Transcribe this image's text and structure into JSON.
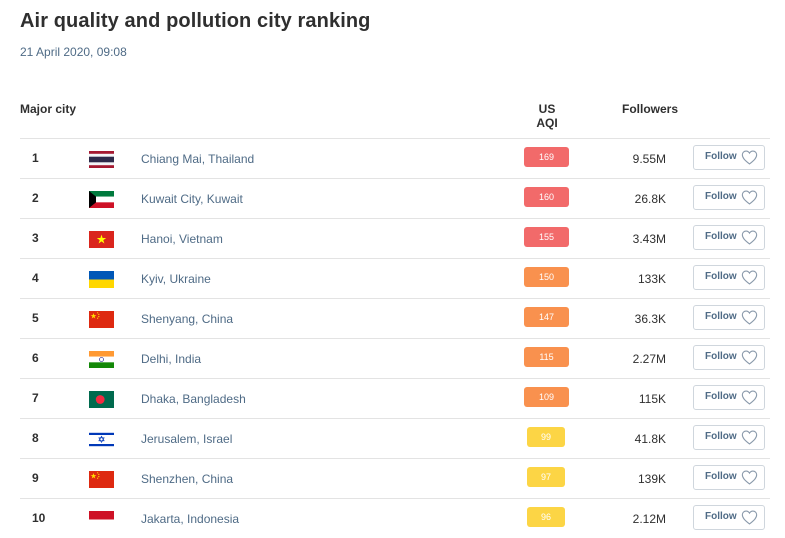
{
  "page": {
    "title": "Air quality and pollution city ranking",
    "datetime": "21 April 2020, 09:08"
  },
  "table": {
    "headers": {
      "city": "Major city",
      "aqi": "US AQI",
      "followers": "Followers"
    },
    "follow_label": "Follow",
    "rows": [
      {
        "rank": "1",
        "flag": "thailand",
        "city": "Chiang Mai, Thailand",
        "aqi": "169",
        "level": "red",
        "followers": "9.55M"
      },
      {
        "rank": "2",
        "flag": "kuwait",
        "city": "Kuwait City, Kuwait",
        "aqi": "160",
        "level": "red",
        "followers": "26.8K"
      },
      {
        "rank": "3",
        "flag": "vietnam",
        "city": "Hanoi, Vietnam",
        "aqi": "155",
        "level": "red",
        "followers": "3.43M"
      },
      {
        "rank": "4",
        "flag": "ukraine",
        "city": "Kyiv, Ukraine",
        "aqi": "150",
        "level": "orange",
        "followers": "133K"
      },
      {
        "rank": "5",
        "flag": "china",
        "city": "Shenyang, China",
        "aqi": "147",
        "level": "orange",
        "followers": "36.3K"
      },
      {
        "rank": "6",
        "flag": "india",
        "city": "Delhi, India",
        "aqi": "115",
        "level": "orange",
        "followers": "2.27M"
      },
      {
        "rank": "7",
        "flag": "bangladesh",
        "city": "Dhaka, Bangladesh",
        "aqi": "109",
        "level": "orange",
        "followers": "115K"
      },
      {
        "rank": "8",
        "flag": "israel",
        "city": "Jerusalem, Israel",
        "aqi": "99",
        "level": "yellow",
        "followers": "41.8K"
      },
      {
        "rank": "9",
        "flag": "china",
        "city": "Shenzhen, China",
        "aqi": "97",
        "level": "yellow",
        "followers": "139K"
      },
      {
        "rank": "10",
        "flag": "indonesia",
        "city": "Jakarta, Indonesia",
        "aqi": "96",
        "level": "yellow",
        "followers": "2.12M"
      }
    ]
  },
  "colors": {
    "aqi_red": "#f26a6a",
    "aqi_orange": "#f9914e",
    "aqi_yellow": "#fcd545",
    "link_blue": "#4f6b86"
  }
}
